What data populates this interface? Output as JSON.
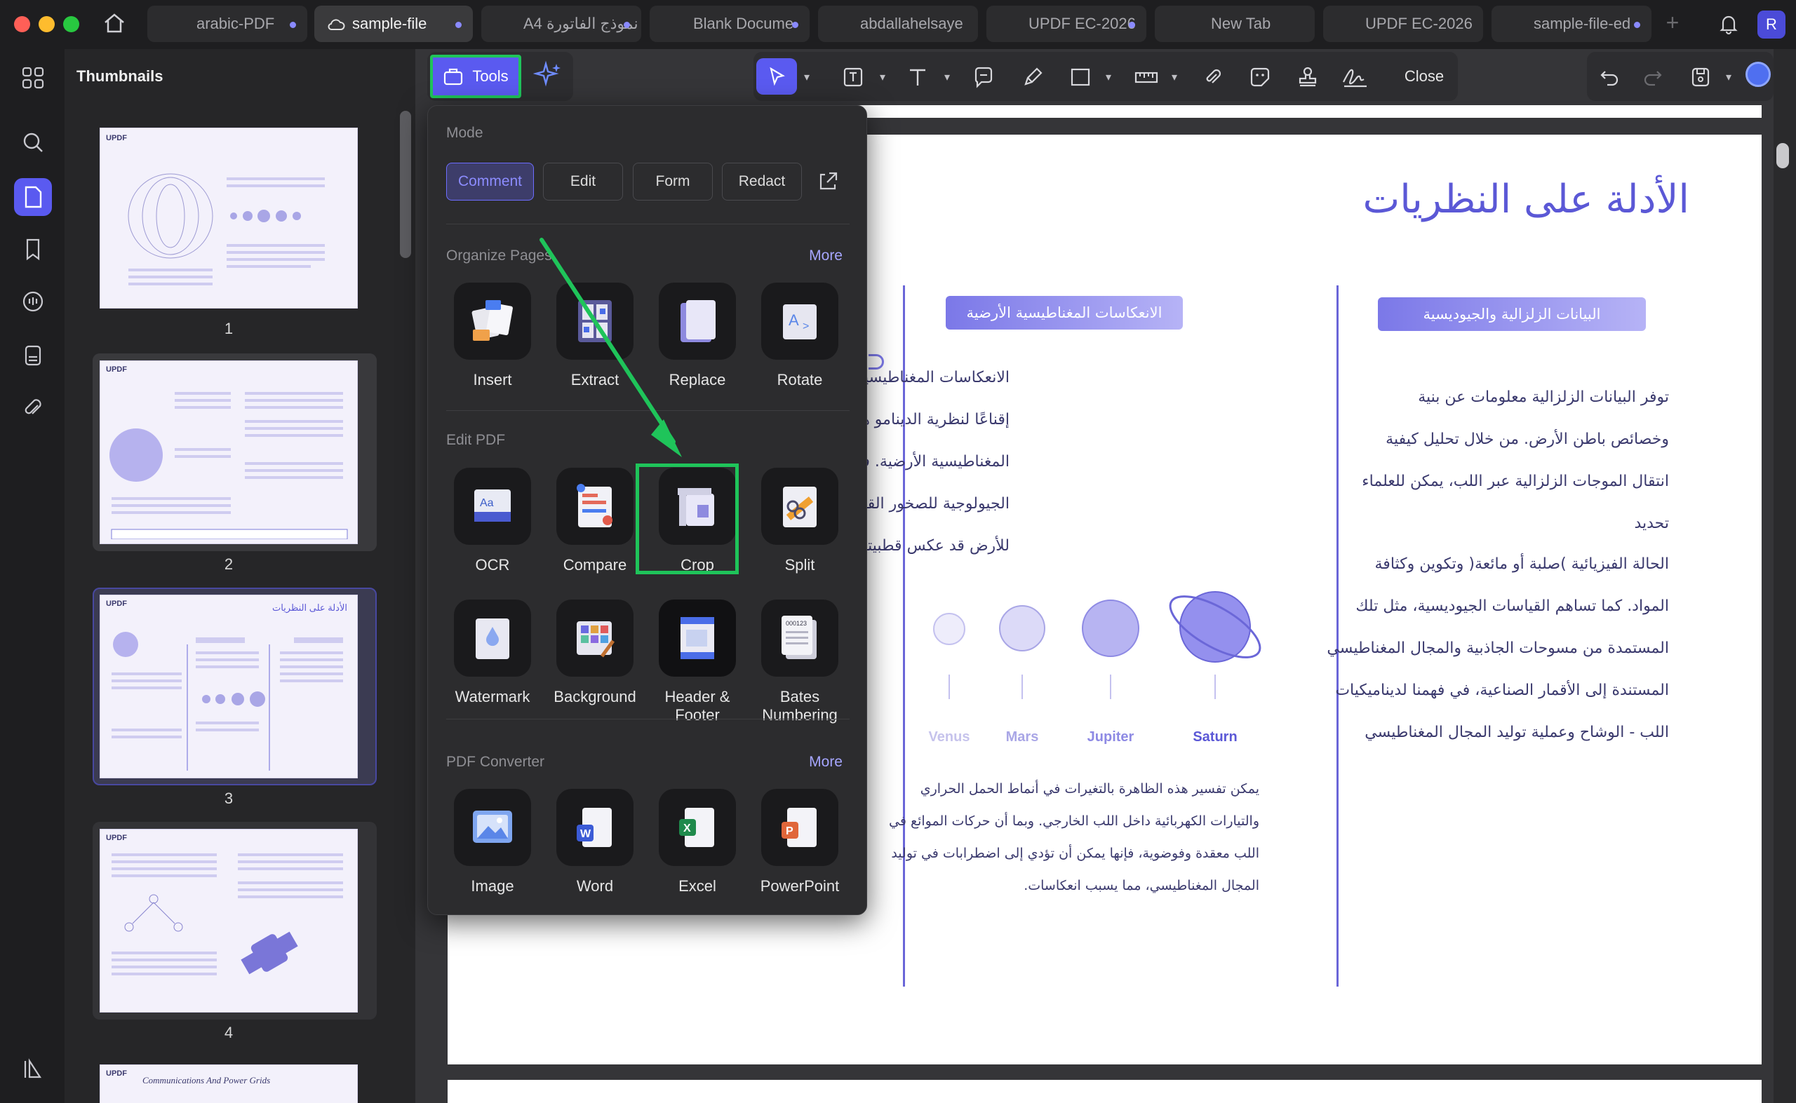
{
  "window": {
    "tabs": [
      {
        "label": "arabic-PDF",
        "active": false
      },
      {
        "label": "sample-file",
        "active": true
      },
      {
        "label": "A4 نموذج الفاتورة",
        "active": false
      },
      {
        "label": "Blank Docume",
        "active": false
      },
      {
        "label": "abdallahelsaye",
        "active": false
      },
      {
        "label": "UPDF EC-2026",
        "active": false
      },
      {
        "label": "New Tab",
        "active": false
      },
      {
        "label": "UPDF EC-2026",
        "active": false
      },
      {
        "label": "sample-file-ed",
        "active": false
      }
    ],
    "avatar_letter": "R"
  },
  "thumbnails": {
    "title": "Thumbnails",
    "pages": [
      "1",
      "2",
      "3",
      "4"
    ],
    "page5_caption": "Communications And Power Grids",
    "brand": "UPDF"
  },
  "toolbar": {
    "tools_label": "Tools",
    "close_label": "Close"
  },
  "popup": {
    "mode_heading": "Mode",
    "modes": [
      "Comment",
      "Edit",
      "Form",
      "Redact"
    ],
    "organize_heading": "Organize Pages",
    "more_label": "More",
    "organize_tools": [
      "Insert",
      "Extract",
      "Replace",
      "Rotate"
    ],
    "edit_heading": "Edit PDF",
    "edit_tools": [
      "OCR",
      "Compare",
      "Crop",
      "Split"
    ],
    "edit_tools_2": [
      "Watermark",
      "Background",
      "Header & Footer",
      "Bates Numbering"
    ],
    "converter_heading": "PDF Converter",
    "converter_tools": [
      "Image",
      "Word",
      "Excel",
      "PowerPoint"
    ]
  },
  "document": {
    "title": "الأدلة على النظريات",
    "left_badge": "الانعكاسات المغناطيسية الأرضية",
    "right_badge": "البيانات الزلزالية والجيوديسية",
    "left_paragraph": [
      "الانعكاسات المغناطيسية الأرضيةأحد أكثر الأدلة",
      "إقناعًا لنظرية الدينامو هو حدوث الانعكاسات",
      "المغناطيسية الأرضية. فقد كشفت الدراسات",
      "الجيولوجية للصخور القديمة أن المجال المغناطيسي",
      "للأرض قد عكس قطبيته عدة مرات في الماضي."
    ],
    "right_paragraph": [
      "توفر البيانات الزلزالية معلومات عن بنية",
      "وخصائص باطن الأرض. من خلال تحليل كيفية",
      "انتقال الموجات الزلزالية عبر اللب، يمكن للعلماء",
      "تحديد",
      "الحالة الفيزيائية )صلبة أو مائعة( وتكوين وكثافة",
      "المواد. كما تساهم القياسات الجيوديسية، مثل تلك",
      "المستمدة من مسوحات الجاذبية والمجال المغناطيسي",
      "المستندة إلى الأقمار الصناعية، في فهمنا لديناميكيات",
      "اللب - الوشاح وعملية توليد المجال المغناطيسي"
    ],
    "planets": [
      "Venus",
      "Mars",
      "Jupiter",
      "Saturn"
    ],
    "bottom_paragraph": [
      "يمكن تفسير هذه الظاهرة بالتغيرات في أنماط الحمل الحراري",
      "والتيارات الكهربائية داخل اللب الخارجي. وبما أن حركات الموائع في",
      "اللب معقدة وفوضوية، فإنها يمكن أن تؤدي إلى اضطرابات في توليد",
      "المجال المغناطيسي، مما يسبب انعكاسات."
    ]
  },
  "colors": {
    "accent": "#7b7bff",
    "highlight_green": "#1fc45a",
    "doc_purple": "#5b58d6"
  }
}
